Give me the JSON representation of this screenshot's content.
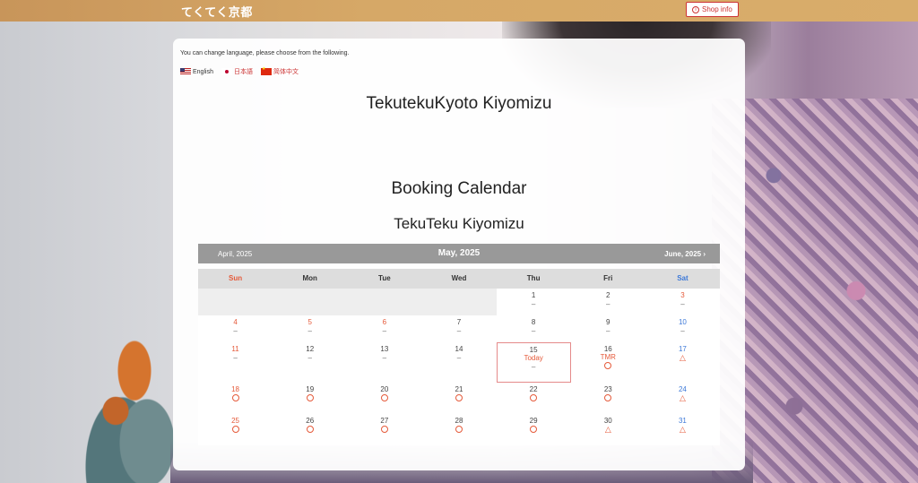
{
  "header": {
    "brand": "てくてく京都",
    "shop_info_label": "Shop info"
  },
  "language": {
    "note": "You can change language, please choose from the following.",
    "options": [
      {
        "label": "English"
      },
      {
        "label": "日本語"
      },
      {
        "label": "简体中文"
      }
    ]
  },
  "titles": {
    "shop_name": "TekutekuKyoto Kiyomizu",
    "calendar_title": "Booking Calendar",
    "branch_name": "TekuTeku Kiyomizu"
  },
  "calendar": {
    "prev_label": "April, 2025",
    "current_label": "May, 2025",
    "next_label": "June, 2025",
    "next_chevron": "›",
    "weekdays": [
      "Sun",
      "Mon",
      "Tue",
      "Wed",
      "Thu",
      "Fri",
      "Sat"
    ],
    "today_label": "Today",
    "tomorrow_label": "TMR",
    "colors": {
      "sunday": "#e55a3a",
      "saturday": "#3d79d8",
      "nav_bg": "#999999",
      "accent": "#cc3333"
    },
    "weeks": [
      [
        null,
        null,
        null,
        null,
        {
          "day": "1",
          "status": "none"
        },
        {
          "day": "2",
          "status": "none"
        },
        {
          "day": "3",
          "status": "none"
        }
      ],
      [
        {
          "day": "4",
          "status": "none"
        },
        {
          "day": "5",
          "status": "none"
        },
        {
          "day": "6",
          "status": "none"
        },
        {
          "day": "7",
          "status": "none"
        },
        {
          "day": "8",
          "status": "none"
        },
        {
          "day": "9",
          "status": "none"
        },
        {
          "day": "10",
          "status": "none"
        }
      ],
      [
        {
          "day": "11",
          "status": "none"
        },
        {
          "day": "12",
          "status": "none"
        },
        {
          "day": "13",
          "status": "none"
        },
        {
          "day": "14",
          "status": "none"
        },
        {
          "day": "15",
          "status": "none",
          "today": true
        },
        {
          "day": "16",
          "status": "available",
          "tomorrow": true
        },
        {
          "day": "17",
          "status": "few"
        }
      ],
      [
        {
          "day": "18",
          "status": "available"
        },
        {
          "day": "19",
          "status": "available"
        },
        {
          "day": "20",
          "status": "available"
        },
        {
          "day": "21",
          "status": "available"
        },
        {
          "day": "22",
          "status": "available"
        },
        {
          "day": "23",
          "status": "available"
        },
        {
          "day": "24",
          "status": "few"
        }
      ],
      [
        {
          "day": "25",
          "status": "available"
        },
        {
          "day": "26",
          "status": "available"
        },
        {
          "day": "27",
          "status": "available"
        },
        {
          "day": "28",
          "status": "available"
        },
        {
          "day": "29",
          "status": "available"
        },
        {
          "day": "30",
          "status": "few"
        },
        {
          "day": "31",
          "status": "few"
        }
      ]
    ],
    "holidays": [
      "3",
      "4",
      "5",
      "6"
    ],
    "marks": {
      "none": "–",
      "few": "△"
    }
  }
}
